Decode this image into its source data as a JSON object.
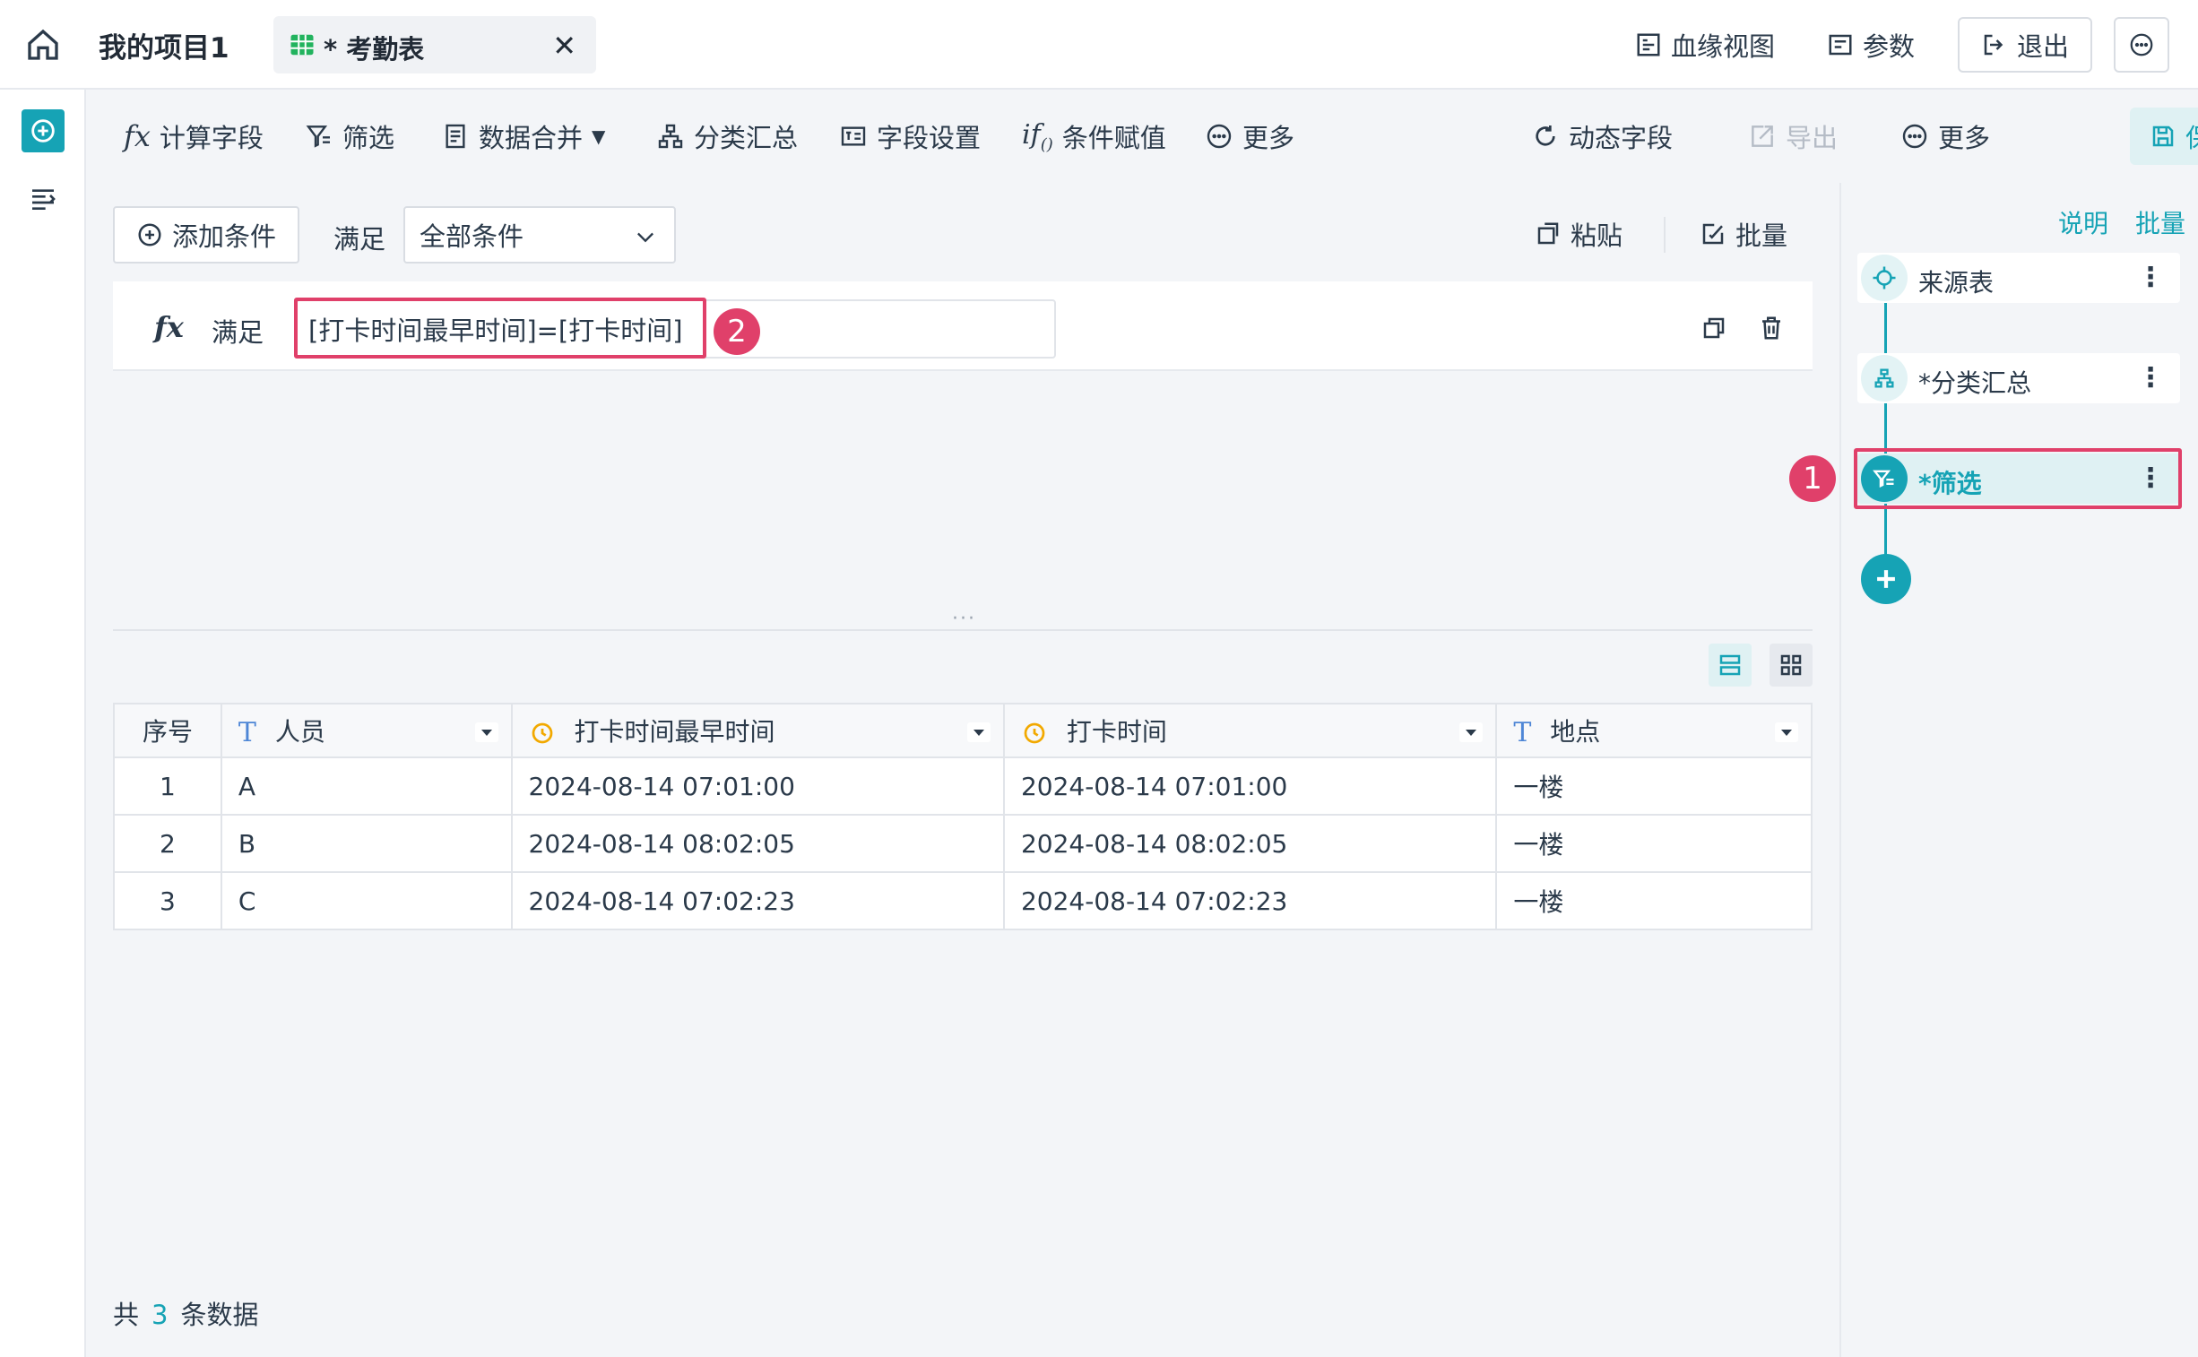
{
  "header": {
    "project_title": "我的项目1",
    "tab_label": "* 考勤表",
    "close_glyph": "✕",
    "lineage_view": "血缘视图",
    "params": "参数",
    "exit": "退出"
  },
  "toolbar": {
    "calc_field": "计算字段",
    "filter": "筛选",
    "merge_data": "数据合并",
    "group_summary": "分类汇总",
    "field_settings": "字段设置",
    "conditional_assign": "条件赋值",
    "more_left": "更多",
    "dynamic_field": "动态字段",
    "export": "导出",
    "more_right": "更多",
    "save": "保存"
  },
  "filter_bar": {
    "add_condition": "添加条件",
    "satisfy": "满足",
    "condition_value": "全部条件",
    "paste": "粘贴",
    "batch": "批量"
  },
  "formula": {
    "fx": "fx",
    "satisfy": "满足",
    "expression": "[打卡时间最早时间]=[打卡时间]"
  },
  "annotations": {
    "badge_1": "1",
    "badge_2": "2"
  },
  "table": {
    "columns": [
      {
        "label": "序号",
        "type": "index"
      },
      {
        "label": "人员",
        "type": "text"
      },
      {
        "label": "打卡时间最早时间",
        "type": "datetime"
      },
      {
        "label": "打卡时间",
        "type": "datetime"
      },
      {
        "label": "地点",
        "type": "text"
      }
    ],
    "rows": [
      [
        "1",
        "A",
        "2024-08-14 07:01:00",
        "2024-08-14 07:01:00",
        "一楼"
      ],
      [
        "2",
        "B",
        "2024-08-14 08:02:05",
        "2024-08-14 08:02:05",
        "一楼"
      ],
      [
        "3",
        "C",
        "2024-08-14 07:02:23",
        "2024-08-14 07:02:23",
        "一楼"
      ]
    ]
  },
  "footer": {
    "prefix": "共",
    "count": "3",
    "suffix": "条数据"
  },
  "flow": {
    "help": "说明",
    "batch": "批量",
    "nodes": [
      {
        "label": "来源表",
        "icon": "crosshair-icon"
      },
      {
        "label": "*分类汇总",
        "icon": "hierarchy-icon"
      },
      {
        "label": "*筛选",
        "icon": "filter-icon",
        "active": true
      }
    ],
    "menu_glyph": "⋮"
  },
  "colors": {
    "accent": "#16a3b5",
    "annotation": "#e0406a"
  }
}
